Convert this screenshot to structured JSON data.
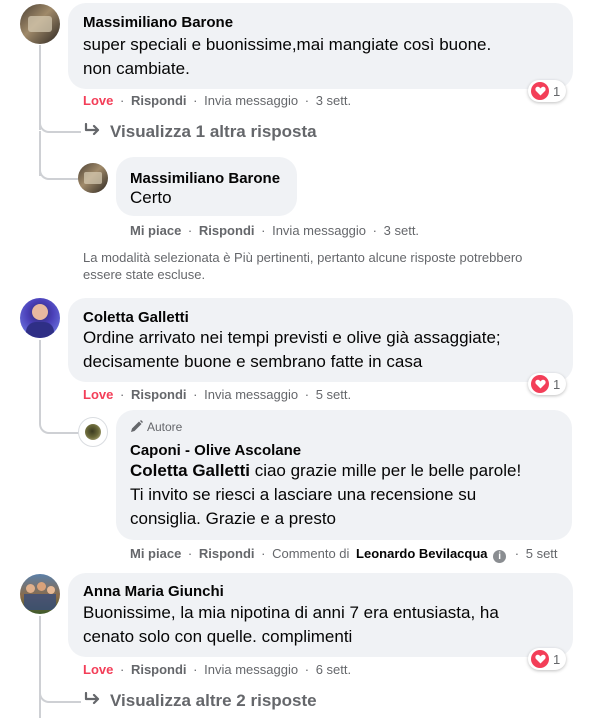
{
  "comments": [
    {
      "author": "Massimiliano Barone",
      "line1": "super speciali e buonissime,mai mangiate così buone.",
      "line2": "non cambiate.",
      "action": "Love",
      "reply": "Rispondi",
      "message": "Invia messaggio",
      "time": "3 sett.",
      "reaction_count": "1",
      "view_more": "Visualizza 1 altra risposta",
      "replies": [
        {
          "author": "Massimiliano Barone",
          "line1": "Certo",
          "action": "Mi piace",
          "reply": "Rispondi",
          "message": "Invia messaggio",
          "time": "3 sett."
        }
      ]
    },
    {
      "author": "Coletta Galletti",
      "line1": "Ordine arrivato nei tempi previsti e olive già assaggiate;",
      "line2": "decisamente buone e sembrano fatte in casa",
      "action": "Love",
      "reply": "Rispondi",
      "message": "Invia messaggio",
      "time": "5 sett.",
      "reaction_count": "1",
      "replies": [
        {
          "badge": "Autore",
          "author": "Caponi - Olive Ascolane",
          "mention": "Coletta Galletti",
          "line1_rest": " ciao grazie mille per le belle parole!",
          "line2": "Ti invito se riesci a lasciare una recensione su",
          "line3": "consiglia. Grazie e a presto",
          "action": "Mi piace",
          "reply": "Rispondi",
          "comment_by": "Commento di",
          "comment_author": "Leonardo Bevilacqua",
          "time": "5 sett"
        }
      ]
    },
    {
      "author": "Anna Maria Giunchi",
      "line1": "Buonissime, la mia nipotina di anni 7 era entusiasta, ha",
      "line2": "cenato solo con quelle. complimenti",
      "action": "Love",
      "reply": "Rispondi",
      "message": "Invia messaggio",
      "time": "6 sett.",
      "reaction_count": "1",
      "view_more": "Visualizza altre 2 risposte"
    }
  ],
  "notice": {
    "line1": "La modalità selezionata è Più pertinenti, pertanto alcune risposte potrebbero",
    "line2": "essere state escluse."
  },
  "separator": "·",
  "icons": {
    "reaction": "heart-icon",
    "view_more": "reply-arrow-icon",
    "badge": "pencil-icon",
    "info": "info-icon"
  },
  "colors": {
    "love": "#f33e58",
    "bubble": "#f0f2f5",
    "meta": "#65676b"
  }
}
